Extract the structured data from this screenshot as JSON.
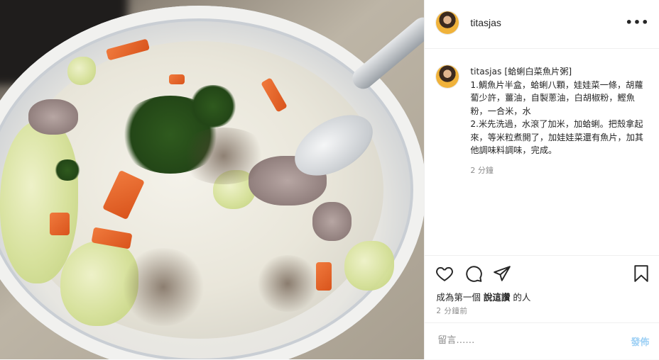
{
  "post": {
    "username": "titasjas",
    "more_label": "•••",
    "caption": {
      "username": "titasjas",
      "title": "[蛤蜊白菜魚片粥]",
      "lines": [
        "1.鯛魚片半盒，蛤蜊八顆，娃娃菜一條，胡蘿蔔少許，薑油，自製蔥油，白胡椒粉，鰹魚粉，一合米，水",
        "2.米先洗過，水滾了加米，加蛤蜊。把殼拿起來，等米粒煮開了，加娃娃菜還有魚片，加其他調味料調味，完成。"
      ],
      "time": "2 分鐘"
    },
    "actions": {
      "icons": [
        "heart-icon",
        "comment-icon",
        "share-icon",
        "bookmark-icon"
      ]
    },
    "likes": {
      "prefix": "成為第一個",
      "bold": "說這讚",
      "suffix": "的人"
    },
    "date": "2 分鐘前",
    "comment_box": {
      "placeholder": "留言……",
      "post_label": "發佈"
    }
  },
  "colors": {
    "text": "#262626",
    "muted": "#8e8e8e",
    "post_button_disabled": "#9dd0f5",
    "border": "#efefef"
  }
}
